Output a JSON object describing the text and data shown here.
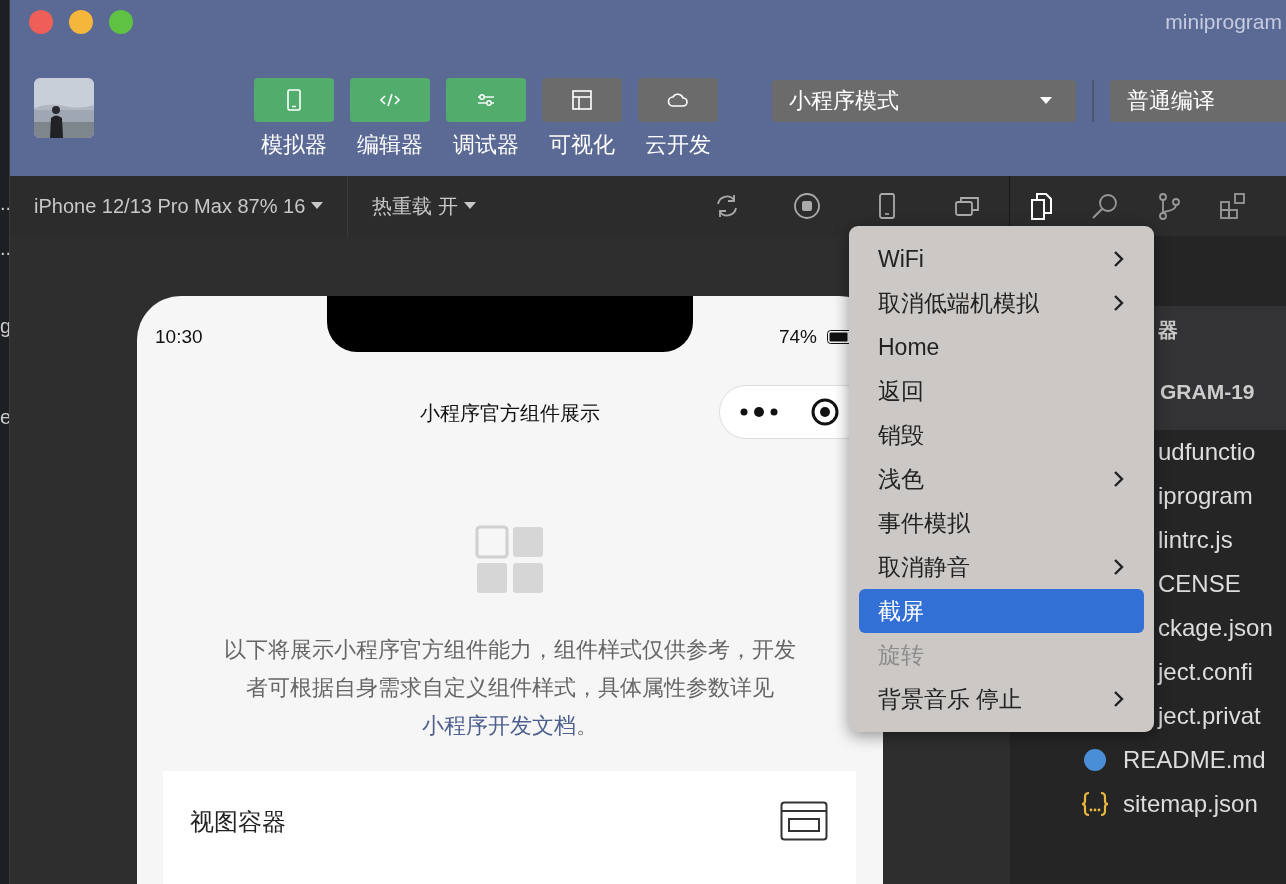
{
  "background_window": {
    "fragments": [
      "..",
      "..",
      "g",
      "e"
    ]
  },
  "window": {
    "title": "miniprogram"
  },
  "mode_buttons": [
    {
      "label": "模拟器",
      "on": true,
      "kind": "phone"
    },
    {
      "label": "编辑器",
      "on": true,
      "kind": "code"
    },
    {
      "label": "调试器",
      "on": true,
      "kind": "sliders"
    },
    {
      "label": "可视化",
      "on": false,
      "kind": "layout"
    },
    {
      "label": "云开发",
      "on": false,
      "kind": "cloud"
    }
  ],
  "mode_select": {
    "value": "小程序模式"
  },
  "compile_select": {
    "value": "普通编译"
  },
  "toolbar": {
    "device": "iPhone 12/13 Pro Max 87% 16",
    "hot_reload": "热重载 开"
  },
  "phone": {
    "time": "10:30",
    "battery": "74%",
    "nav_title": "小程序官方组件展示",
    "intro": "以下将展示小程序官方组件能力，组件样式仅供参考，开发者可根据自身需求自定义组件样式，具体属性参数详见 ",
    "intro_link": "小程序开发文档",
    "intro_end": "。",
    "cards": [
      {
        "label": "视图容器"
      }
    ]
  },
  "explorer": {
    "section": "器",
    "project": "GRAM-19",
    "files": [
      {
        "name": "udfunctio",
        "kind": "hidden"
      },
      {
        "name": "iprogram",
        "kind": "hidden"
      },
      {
        "name": "lintrc.js",
        "kind": "hidden"
      },
      {
        "name": "CENSE",
        "kind": "hidden"
      },
      {
        "name": "ckage.json",
        "kind": "hidden"
      },
      {
        "name": "ject.confi",
        "kind": "hidden"
      },
      {
        "name": "ject.privat",
        "kind": "hidden"
      },
      {
        "name": "README.md",
        "kind": "info"
      },
      {
        "name": "sitemap.json",
        "kind": "json"
      }
    ]
  },
  "context_menu": {
    "items": [
      {
        "label": "WiFi",
        "submenu": true,
        "selected": false,
        "disabled": false
      },
      {
        "label": "取消低端机模拟",
        "submenu": true,
        "selected": false,
        "disabled": false
      },
      {
        "label": "Home",
        "submenu": false,
        "selected": false,
        "disabled": false
      },
      {
        "label": "返回",
        "submenu": false,
        "selected": false,
        "disabled": false
      },
      {
        "label": "销毁",
        "submenu": false,
        "selected": false,
        "disabled": false
      },
      {
        "label": "浅色",
        "submenu": true,
        "selected": false,
        "disabled": false
      },
      {
        "label": "事件模拟",
        "submenu": false,
        "selected": false,
        "disabled": false
      },
      {
        "label": "取消静音",
        "submenu": true,
        "selected": false,
        "disabled": false
      },
      {
        "label": "截屏",
        "submenu": false,
        "selected": true,
        "disabled": false
      },
      {
        "label": "旋转",
        "submenu": false,
        "selected": false,
        "disabled": true
      },
      {
        "label": "背景音乐 停止",
        "submenu": true,
        "selected": false,
        "disabled": false
      }
    ]
  }
}
